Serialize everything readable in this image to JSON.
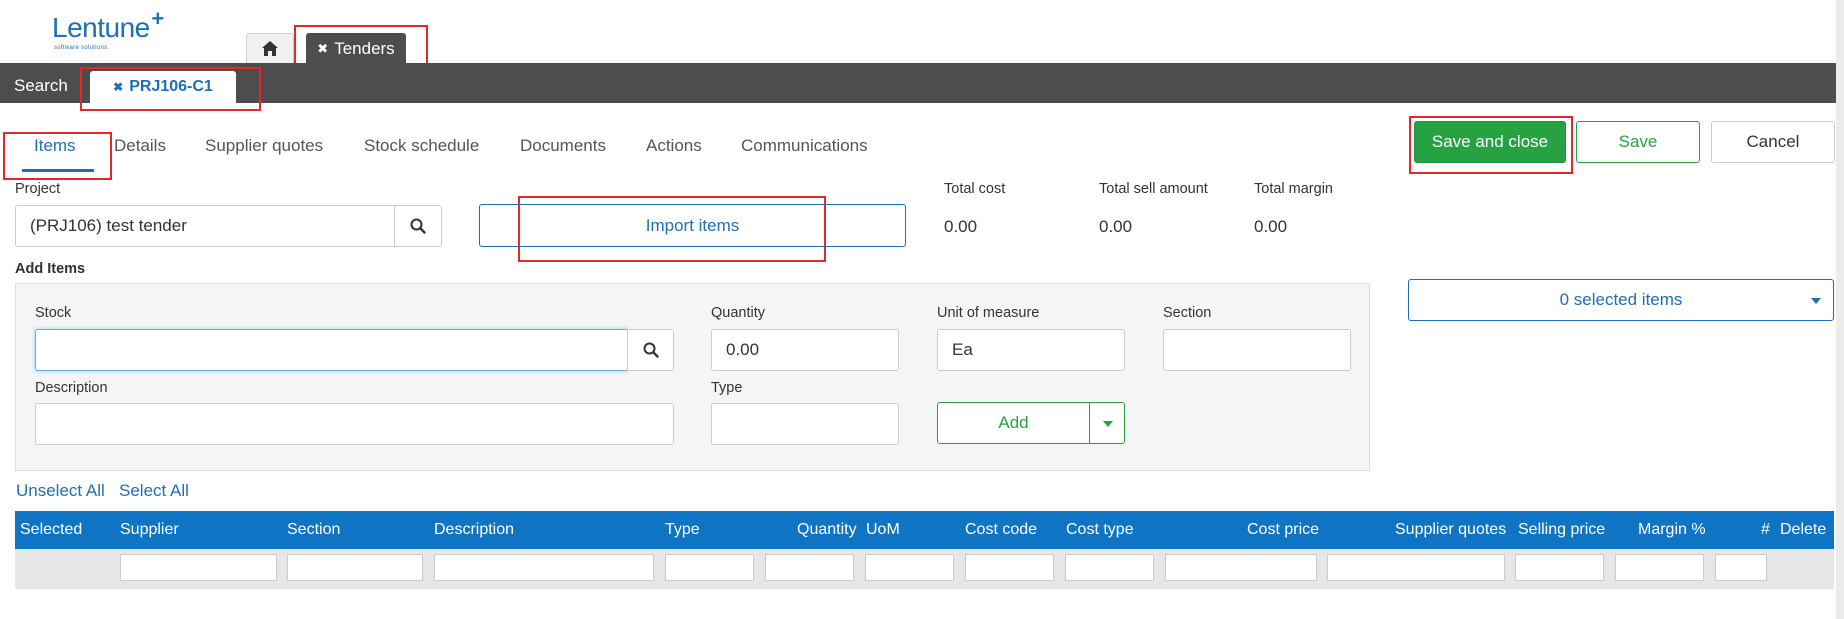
{
  "app": {
    "logo_text": "Lentune",
    "logo_plus": "+",
    "logo_sub": "software solutions"
  },
  "top_tabs": {
    "home_icon": "home-icon",
    "tenders_label": "Tenders",
    "close_glyph": "✖"
  },
  "subbar": {
    "search_label": "Search",
    "record_tab_label": "PRJ106-C1",
    "close_glyph": "✖"
  },
  "nav_tabs": [
    {
      "label": "Items"
    },
    {
      "label": "Details"
    },
    {
      "label": "Supplier quotes"
    },
    {
      "label": "Stock schedule"
    },
    {
      "label": "Documents"
    },
    {
      "label": "Actions"
    },
    {
      "label": "Communications"
    }
  ],
  "actions": {
    "save_close_label": "Save and close",
    "save_label": "Save",
    "cancel_label": "Cancel"
  },
  "project": {
    "label": "Project",
    "value": "(PRJ106) test tender",
    "search_icon": "search-icon"
  },
  "import": {
    "label": "Import items"
  },
  "totals": {
    "total_cost_label": "Total cost",
    "total_cost_value": "0.00",
    "total_sell_label": "Total sell amount",
    "total_sell_value": "0.00",
    "total_margin_label": "Total margin",
    "total_margin_value": "0.00"
  },
  "add_items": {
    "title": "Add Items",
    "stock_label": "Stock",
    "stock_value": "",
    "quantity_label": "Quantity",
    "quantity_value": "0.00",
    "uom_label": "Unit of measure",
    "uom_value": "Ea",
    "section_label": "Section",
    "section_value": "",
    "description_label": "Description",
    "description_value": "",
    "type_label": "Type",
    "type_value": "",
    "add_label": "Add"
  },
  "selection": {
    "dropdown_label": "0 selected items",
    "unselect_all": "Unselect All",
    "select_all": "Select All"
  },
  "table": {
    "columns": [
      "Selected",
      "Supplier",
      "Section",
      "Description",
      "Type",
      "Quantity",
      "UoM",
      "Cost code",
      "Cost type",
      "Cost price",
      "Supplier quotes",
      "Selling price",
      "Margin %",
      "#",
      "Delete"
    ]
  },
  "colors": {
    "brand_blue": "#1f6fb5",
    "header_blue": "#0f74c3",
    "success_green": "#27a243",
    "dark_bar": "#4d4d4d",
    "highlight_red": "#e8262a"
  }
}
